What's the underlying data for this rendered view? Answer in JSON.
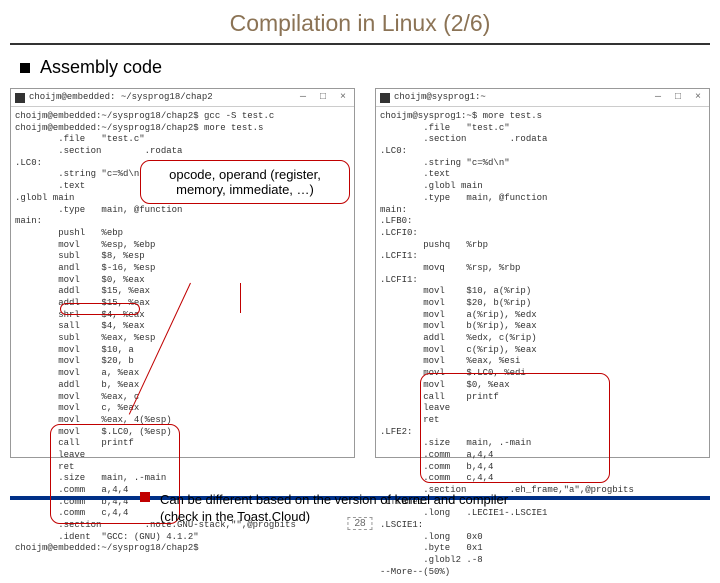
{
  "title": "Compilation in Linux (2/6)",
  "main_bullet": "Assembly code",
  "callout": {
    "line1": "opcode, operand (register,",
    "line2": "memory, immediate, …)"
  },
  "note": {
    "line1": "Can be different based on the version of kernel and compiler",
    "line2": "(check in the Toast.Cloud)"
  },
  "page_number": "28",
  "terminals": {
    "left": {
      "title": "choijm@embedded: ~/sysprog18/chap2",
      "controls": "— □ ×",
      "body": "choijm@embedded:~/sysprog18/chap2$ gcc -S test.c\nchoijm@embedded:~/sysprog18/chap2$ more test.s\n        .file   \"test.c\"\n        .section        .rodata\n.LC0:\n        .string \"c=%d\\n\"\n        .text\n.globl main\n        .type   main, @function\nmain:\n        pushl   %ebp\n        movl    %esp, %ebp\n        subl    $8, %esp\n        andl    $-16, %esp\n        movl    $0, %eax\n        addl    $15, %eax\n        addl    $15, %eax\n        shrl    $4, %eax\n        sall    $4, %eax\n        subl    %eax, %esp\n        movl    $10, a\n        movl    $20, b\n        movl    a, %eax\n        addl    b, %eax\n        movl    %eax, c\n        movl    c, %eax\n        movl    %eax, 4(%esp)\n        movl    $.LC0, (%esp)\n        call    printf\n        leave\n        ret\n        .size   main, .-main\n        .comm   a,4,4\n        .comm   b,4,4\n        .comm   c,4,4\n        .section        .note.GNU-stack,\"\",@progbits\n        .ident  \"GCC: (GNU) 4.1.2\"\nchoijm@embedded:~/sysprog18/chap2$"
    },
    "right": {
      "title": "choijm@sysprog1:~",
      "controls": "— □ ×",
      "body": "choijm@sysprog1:~$ more test.s\n        .file   \"test.c\"\n        .section        .rodata\n.LC0:\n        .string \"c=%d\\n\"\n        .text\n        .globl main\n        .type   main, @function\nmain:\n.LFB0:\n.LCFI0:\n        pushq   %rbp\n.LCFI1:\n        movq    %rsp, %rbp\n.LCFI1:\n        movl    $10, a(%rip)\n        movl    $20, b(%rip)\n        movl    a(%rip), %edx\n        movl    b(%rip), %eax\n        addl    %edx, c(%rip)\n        movl    c(%rip), %eax\n        movl    %eax, %esi\n        movl    $.LC0, %edi\n        movl    $0, %eax\n        call    printf\n        leave\n        ret\n.LFE2:\n        .size   main, .-main\n        .comm   a,4,4\n        .comm   b,4,4\n        .comm   c,4,4\n        .section        .eh_frame,\"a\",@progbits\n.Lframe1:\n        .long   .LECIE1-.LSCIE1\n.LSCIE1:\n        .long   0x0\n        .byte   0x1\n        .globl2 .-8\n--More--(50%)"
    }
  }
}
